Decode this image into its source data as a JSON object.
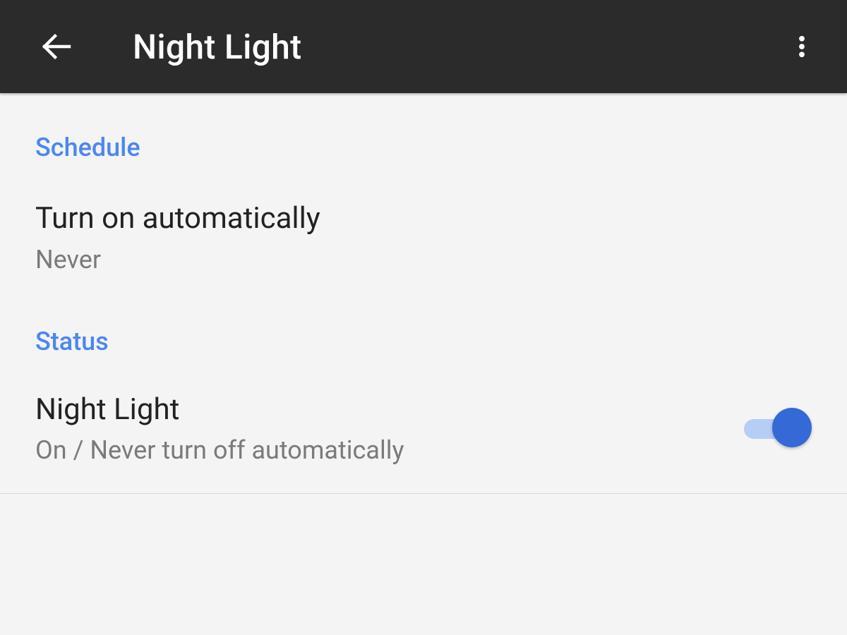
{
  "appbar": {
    "title": "Night Light"
  },
  "sections": {
    "schedule": {
      "header": "Schedule",
      "auto_on": {
        "title": "Turn on automatically",
        "value": "Never"
      }
    },
    "status": {
      "header": "Status",
      "night_light": {
        "title": "Night Light",
        "value": "On / Never turn off automatically",
        "enabled": true
      }
    }
  }
}
